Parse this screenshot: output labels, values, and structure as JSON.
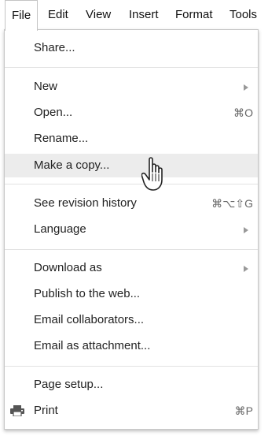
{
  "menubar": {
    "items": [
      {
        "label": "File",
        "active": true
      },
      {
        "label": "Edit"
      },
      {
        "label": "View"
      },
      {
        "label": "Insert"
      },
      {
        "label": "Format"
      },
      {
        "label": "Tools"
      }
    ]
  },
  "file_menu": {
    "items": [
      {
        "label": "Share...",
        "shortcut": "",
        "submenu": false
      },
      {
        "label": "New",
        "shortcut": "",
        "submenu": true
      },
      {
        "label": "Open...",
        "shortcut": "⌘O",
        "submenu": false
      },
      {
        "label": "Rename...",
        "shortcut": "",
        "submenu": false
      },
      {
        "label": "Make a copy...",
        "shortcut": "",
        "submenu": false,
        "highlighted": true
      },
      {
        "label": "See revision history",
        "shortcut": "⌘⌥⇧G",
        "submenu": false
      },
      {
        "label": "Language",
        "shortcut": "",
        "submenu": true
      },
      {
        "label": "Download as",
        "shortcut": "",
        "submenu": true
      },
      {
        "label": "Publish to the web...",
        "shortcut": "",
        "submenu": false
      },
      {
        "label": "Email collaborators...",
        "shortcut": "",
        "submenu": false
      },
      {
        "label": "Email as attachment...",
        "shortcut": "",
        "submenu": false
      },
      {
        "label": "Page setup...",
        "shortcut": "",
        "submenu": false
      },
      {
        "label": "Print",
        "shortcut": "⌘P",
        "submenu": false,
        "icon": "printer-icon"
      }
    ]
  },
  "cursor": {
    "icon": "hand-pointer-icon"
  },
  "colors": {
    "highlight": "#ececec",
    "border": "#c8c8c8",
    "separator": "#e2e2e2",
    "shortcut_text": "#666666"
  }
}
